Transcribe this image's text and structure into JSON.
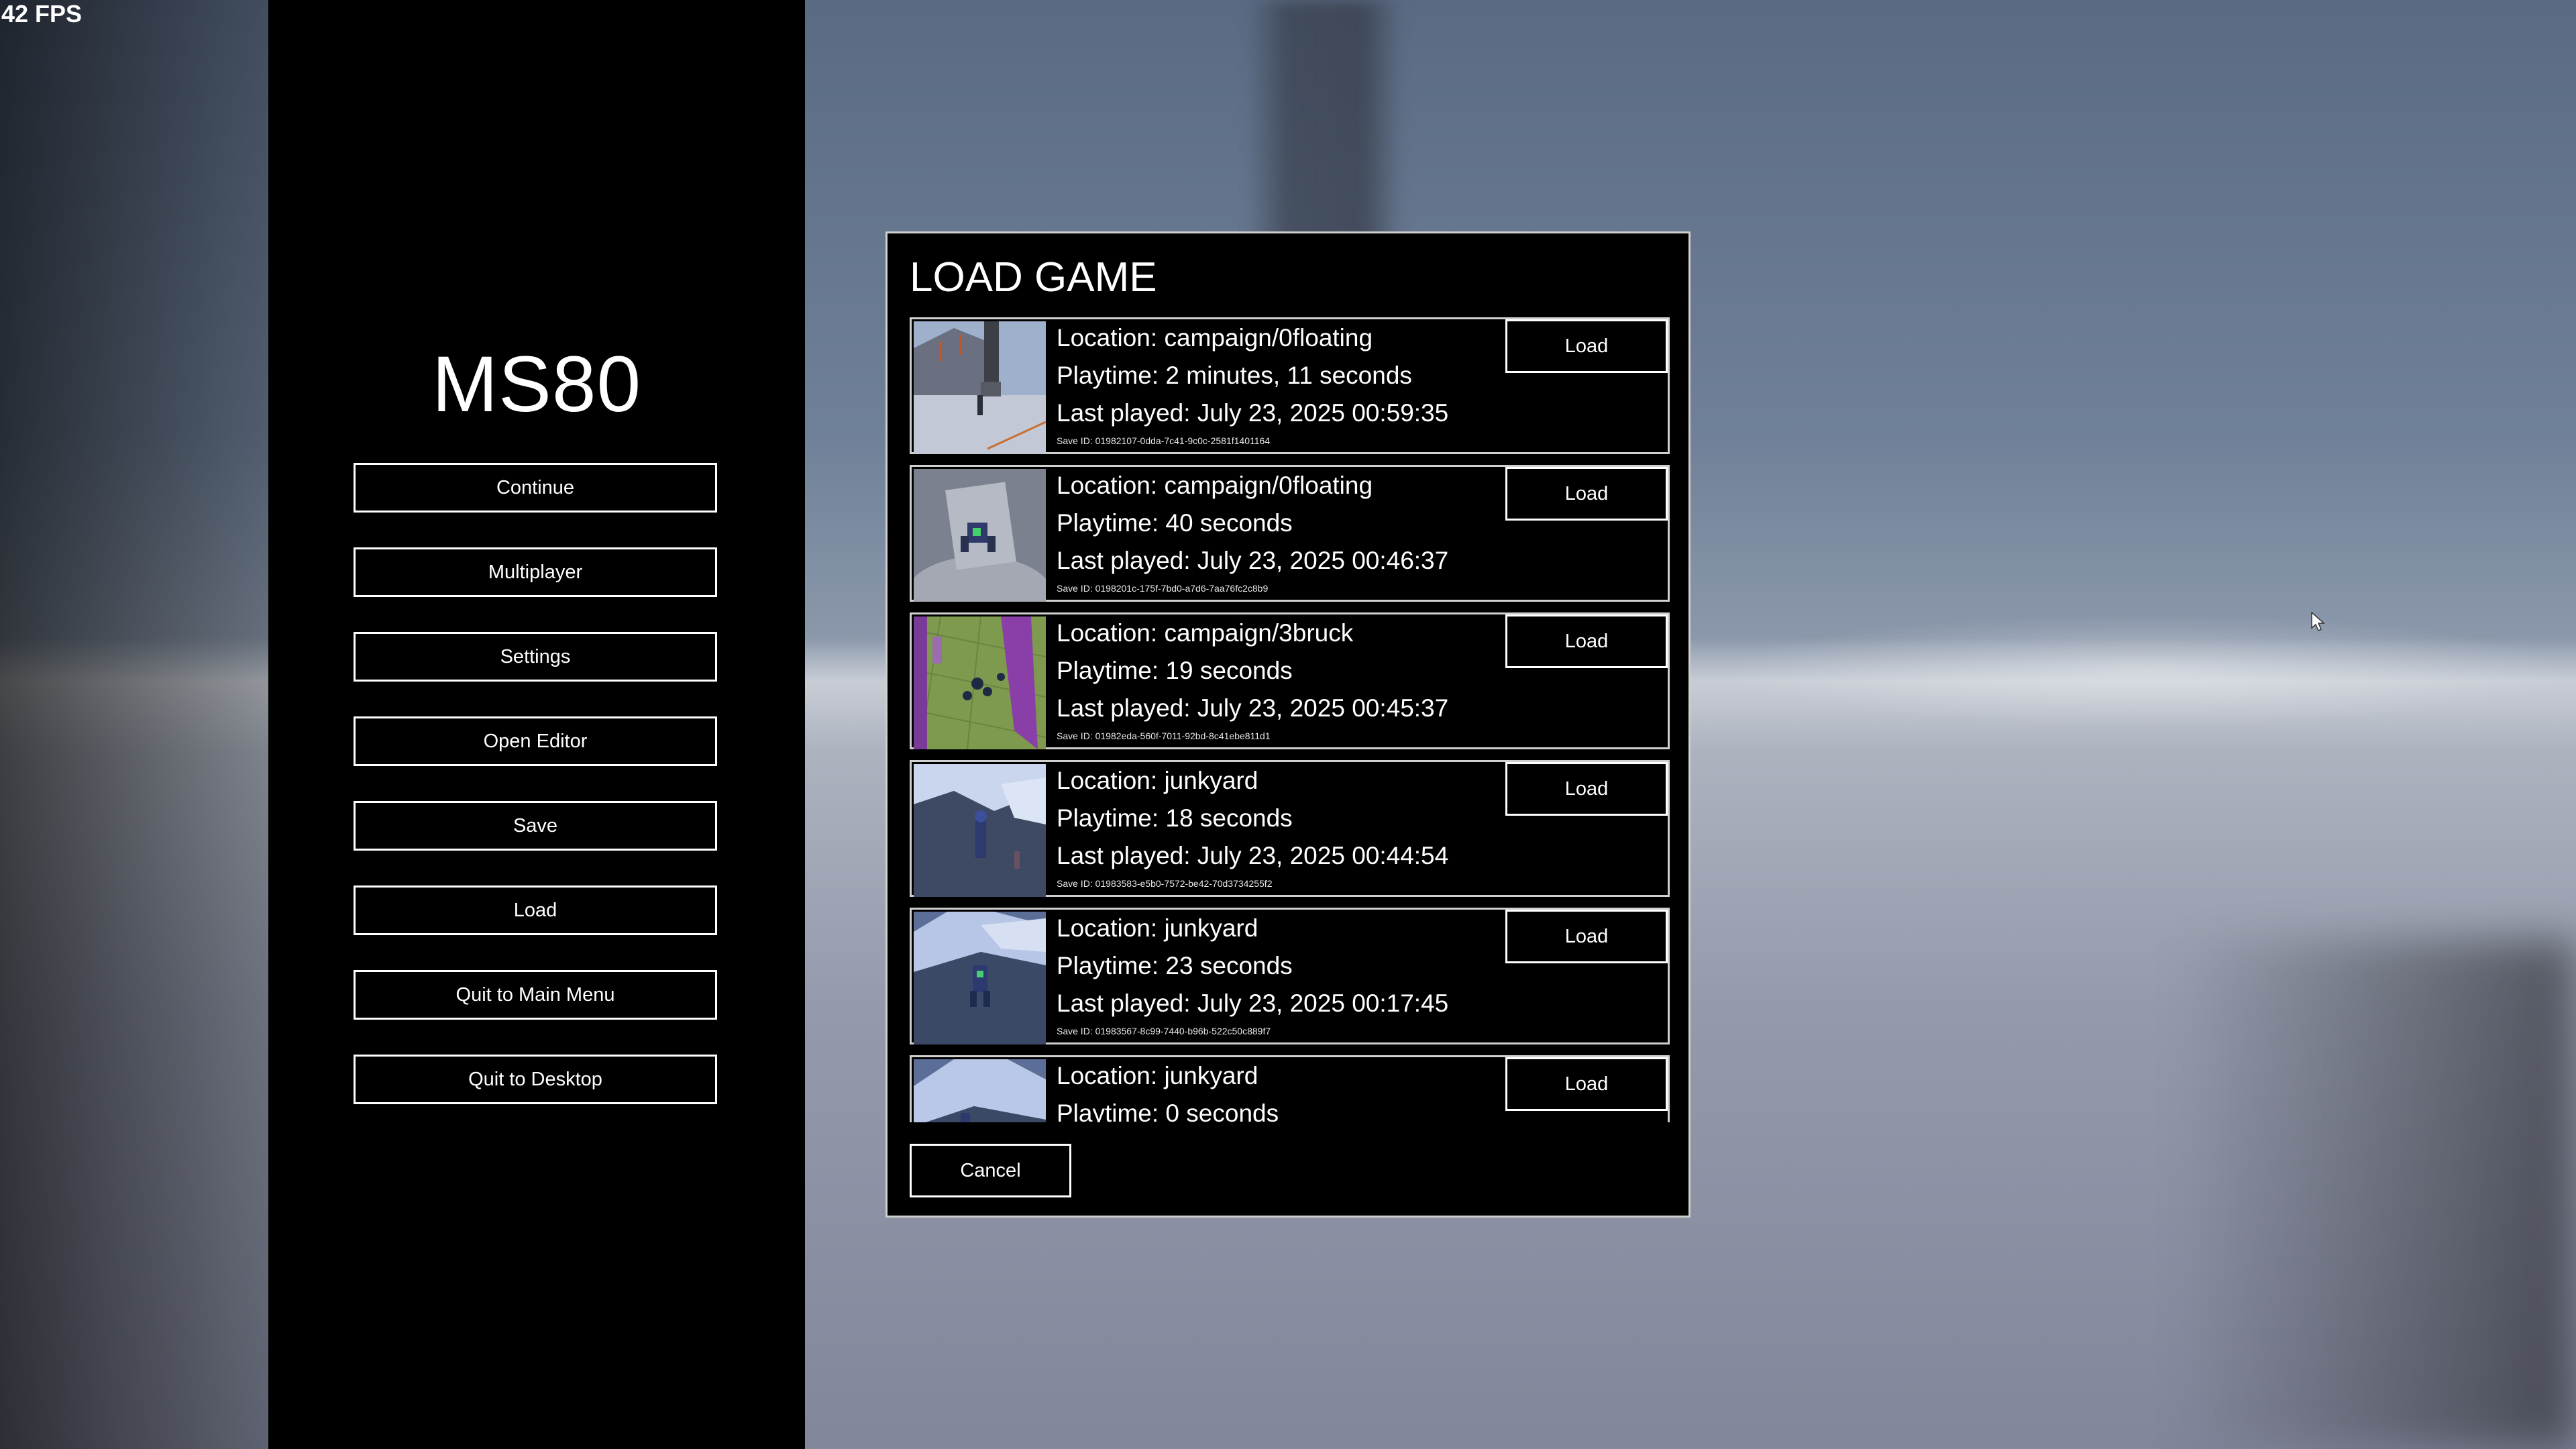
{
  "hud": {
    "fps": "42 FPS"
  },
  "menu": {
    "title": "MS80",
    "buttons": [
      "Continue",
      "Multiplayer",
      "Settings",
      "Open Editor",
      "Save",
      "Load",
      "Quit to Main Menu",
      "Quit to Desktop"
    ]
  },
  "dialog": {
    "title": "LOAD GAME",
    "cancel_label": "Cancel",
    "load_label": "Load",
    "saves": [
      {
        "location": "Location: campaign/0floating",
        "playtime": "Playtime: 2 minutes, 11 seconds",
        "last_played": "Last played: July 23, 2025 00:59:35",
        "save_id": "Save ID: 01982107-0dda-7c41-9c0c-2581f1401164"
      },
      {
        "location": "Location: campaign/0floating",
        "playtime": "Playtime: 40 seconds",
        "last_played": "Last played: July 23, 2025 00:46:37",
        "save_id": "Save ID: 0198201c-175f-7bd0-a7d6-7aa76fc2c8b9"
      },
      {
        "location": "Location: campaign/3bruck",
        "playtime": "Playtime: 19 seconds",
        "last_played": "Last played: July 23, 2025 00:45:37",
        "save_id": "Save ID: 01982eda-560f-7011-92bd-8c41ebe811d1"
      },
      {
        "location": "Location: junkyard",
        "playtime": "Playtime: 18 seconds",
        "last_played": "Last played: July 23, 2025 00:44:54",
        "save_id": "Save ID: 01983583-e5b0-7572-be42-70d3734255f2"
      },
      {
        "location": "Location: junkyard",
        "playtime": "Playtime: 23 seconds",
        "last_played": "Last played: July 23, 2025 00:17:45",
        "save_id": "Save ID: 01983567-8c99-7440-b96b-522c50c889f7"
      },
      {
        "location": "Location: junkyard",
        "playtime": "Playtime: 0 seconds",
        "last_played": "",
        "save_id": ""
      }
    ]
  }
}
